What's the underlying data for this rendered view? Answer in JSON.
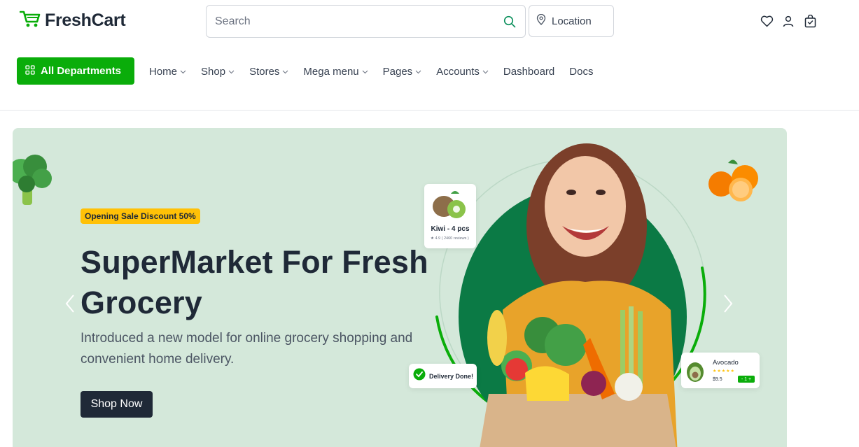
{
  "header": {
    "brand": "FreshCart",
    "search": {
      "placeholder": "Search",
      "value": ""
    },
    "location_label": "Location"
  },
  "nav": {
    "all_departments": "All Departments",
    "items": [
      {
        "label": "Home",
        "dropdown": true
      },
      {
        "label": "Shop",
        "dropdown": true
      },
      {
        "label": "Stores",
        "dropdown": true
      },
      {
        "label": "Mega menu",
        "dropdown": true
      },
      {
        "label": "Pages",
        "dropdown": true
      },
      {
        "label": "Accounts",
        "dropdown": true
      },
      {
        "label": "Dashboard",
        "dropdown": false
      },
      {
        "label": "Docs",
        "dropdown": false
      }
    ]
  },
  "hero": {
    "badge": "Opening Sale Discount 50%",
    "title": "SuperMarket For Fresh Grocery",
    "description": "Introduced a new model for online grocery shopping and convenient home delivery.",
    "cta": "Shop Now",
    "cards": {
      "kiwi": {
        "name": "Kiwi - 4 pcs",
        "rating": "★ 4.9  ( 2460 reviews )"
      },
      "delivery": {
        "text": "Delivery Done!"
      },
      "avocado": {
        "name": "Avocado",
        "stars": "★★★★★",
        "price": "$9.5",
        "qty": "- 1 +"
      }
    }
  },
  "colors": {
    "brand_green": "#0aad0a",
    "hero_bg": "#d4e8da",
    "badge_yellow": "#ffc107",
    "dark": "#1f2937"
  }
}
